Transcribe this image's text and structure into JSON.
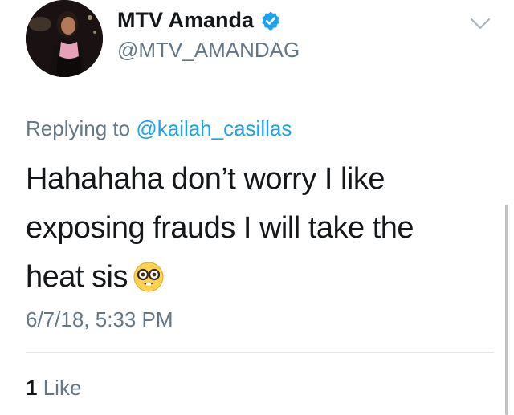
{
  "user": {
    "display_name": "MTV Amanda",
    "handle": "@MTV_AMANDAG",
    "verified": true
  },
  "reply": {
    "prefix": "Replying to",
    "target": "@kailah_casillas"
  },
  "tweet": {
    "lines": [
      "Hahahaha don’t worry I like",
      "exposing frauds I will take the",
      "heat sis"
    ],
    "emoji": "nerd-face"
  },
  "timestamp": "6/7/18, 5:33 PM",
  "likes": {
    "count": "1",
    "label": "Like"
  },
  "colors": {
    "verified_blue": "#1da1f2",
    "secondary_text": "#657786",
    "primary_text": "#14171a"
  },
  "icons": [
    "verified-badge-icon",
    "chevron-down-icon",
    "nerd-face-emoji"
  ]
}
